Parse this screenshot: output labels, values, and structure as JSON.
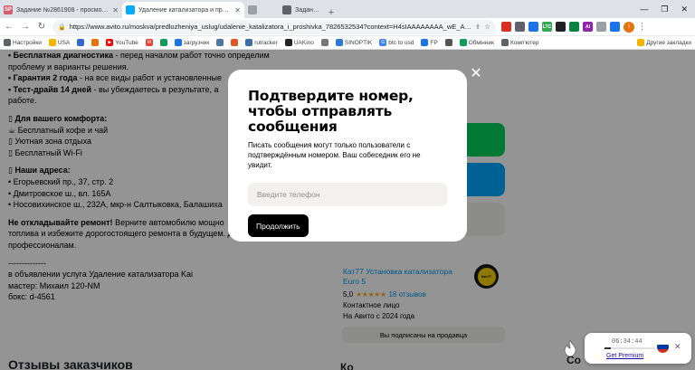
{
  "browser": {
    "tabs": [
      {
        "title": "Задание №2861908 - просмотр з",
        "favicon": "SP",
        "color": "#d35d6e",
        "active": false
      },
      {
        "title": "Удаление катализатора и прошив",
        "favicon": "",
        "color": "#00aaff",
        "active": true
      },
      {
        "title": "",
        "favicon": "",
        "color": "#9aa0a6",
        "active": false
      },
      {
        "title": "Задание №",
        "favicon": "",
        "color": "#5f6368",
        "active": false
      }
    ],
    "url": "https://www.avito.ru/moskva/predlozheniya_uslug/udalenie_katalizatora_i_proshivka_7826532534?context=H4sIAAAAAAAA_wE_AMD_YTo...",
    "ext_badges": [
      "LTC",
      "81.1",
      "AI"
    ],
    "bookmarks": [
      {
        "label": "Настройки",
        "icon": "gear-icon",
        "color": "#5f6368"
      },
      {
        "label": "USA",
        "icon": "folder-icon",
        "color": "#f4b400"
      },
      {
        "label": "",
        "icon": "square-icon",
        "color": "#3367d6"
      },
      {
        "label": "",
        "icon": "square-icon",
        "color": "#e8710a"
      },
      {
        "label": "YouTube",
        "icon": "youtube-icon",
        "color": "#ff0000"
      },
      {
        "label": "",
        "icon": "gmail-icon",
        "color": "#ea4335"
      },
      {
        "label": "",
        "icon": "drive-icon",
        "color": "#0f9d58"
      },
      {
        "label": "загрузчик",
        "icon": "download-icon",
        "color": "#1a73e8"
      },
      {
        "label": "",
        "icon": "square-icon",
        "color": "#4c75a3"
      },
      {
        "label": "",
        "icon": "square-icon",
        "color": "#e25822"
      },
      {
        "label": "rutracker",
        "icon": "rutracker-icon",
        "color": "#3a6ea5"
      },
      {
        "label": "UAKino",
        "icon": "square-icon",
        "color": "#222222"
      },
      {
        "label": "",
        "icon": "square-icon",
        "color": "#777777"
      },
      {
        "label": "SINOPTIK",
        "icon": "weather-icon",
        "color": "#2b7bd8"
      },
      {
        "label": "btc to usd",
        "icon": "search-icon",
        "color": "#4285f4"
      },
      {
        "label": "FP",
        "icon": "square-icon",
        "color": "#1a73e8"
      },
      {
        "label": "",
        "icon": "square-icon",
        "color": "#555555"
      },
      {
        "label": "Обмінник",
        "icon": "exchange-icon",
        "color": "#0f9d58"
      },
      {
        "label": "Комп'ютер",
        "icon": "computer-icon",
        "color": "#5f6368"
      }
    ],
    "bookmarks_right": "Другие закладки"
  },
  "page": {
    "left_lines": [
      {
        "bold": "• Бесплатная диагностика",
        "rest": " - перед началом работ точно определим"
      },
      {
        "bold": "",
        "rest": "проблему и варианты решения."
      },
      {
        "bold": "• Гарантия 2 года",
        "rest": " - на все виды работ и установленные"
      },
      {
        "bold": "• Тест-драйв 14 дней",
        "rest": " - вы убеждаетесь в результате, а"
      },
      {
        "bold": "",
        "rest": "работе."
      },
      {
        "bold": "",
        "rest": ""
      },
      {
        "bold": "▯ Для вашего комфорта:",
        "rest": ""
      },
      {
        "bold": "",
        "rest": "☕ Бесплатный кофе и чай"
      },
      {
        "bold": "",
        "rest": "▯ Уютная зона отдыха"
      },
      {
        "bold": "",
        "rest": "▯ Бесплатный Wi-Fi"
      },
      {
        "bold": "",
        "rest": ""
      },
      {
        "bold": "▯ Наши адреса:",
        "rest": ""
      },
      {
        "bold": "",
        "rest": "• Егорьевский пр., 37, стр. 2"
      },
      {
        "bold": "",
        "rest": "• Дмитровское ш., вл. 165А"
      },
      {
        "bold": "",
        "rest": "• Носовихинское ш., 232А, мкр-н Салтыковка, Балашиха"
      },
      {
        "bold": "",
        "rest": ""
      },
      {
        "bold": "Не откладывайте ремонт!",
        "rest": " Верните автомобилю мощно"
      },
      {
        "bold": "",
        "rest": "топлива и избежите дорогостоящего ремонта в будущем. Доверьтесь"
      },
      {
        "bold": "",
        "rest": "профессионалам."
      },
      {
        "bold": "",
        "rest": ""
      },
      {
        "bold": "",
        "rest": "--------------"
      },
      {
        "bold": "",
        "rest": "в объявлении услуга Удаление катализатора Kai"
      },
      {
        "bold": "",
        "rest": "мастер: Михаил 120-NM"
      },
      {
        "bold": "",
        "rest": "бокс: d-4561"
      }
    ],
    "reviews_heading": "Отзывы заказчиков",
    "seller": {
      "name": "Кат77 Установка катализатора Euro 5",
      "rating": "5,0",
      "stars": "★★★★★",
      "reviews": "18 отзывов",
      "type": "Контактное лицо",
      "since": "На Авито с 2024 года",
      "logo_text": "Кат77",
      "subscribe_label": "Вы подписаны на продавца"
    },
    "bottom_k": "Ко",
    "bottom_co": "Со",
    "colors": {
      "green": "#02d15c",
      "blue": "#00aaff",
      "link": "#0099f7"
    }
  },
  "modal": {
    "title": "Подтвердите номер, чтобы отправлять сообщения",
    "description": "Писать сообщения могут только пользователи с подтверждённым номером. Ваш собеседник его не увидит.",
    "phone_placeholder": "Введите телефон",
    "phone_value": "",
    "continue_label": "Продолжить",
    "close_glyph": "✕"
  },
  "timer_widget": {
    "time": "06:34:44",
    "link": "Get Premium",
    "progress": 0.12,
    "close": "✕"
  }
}
